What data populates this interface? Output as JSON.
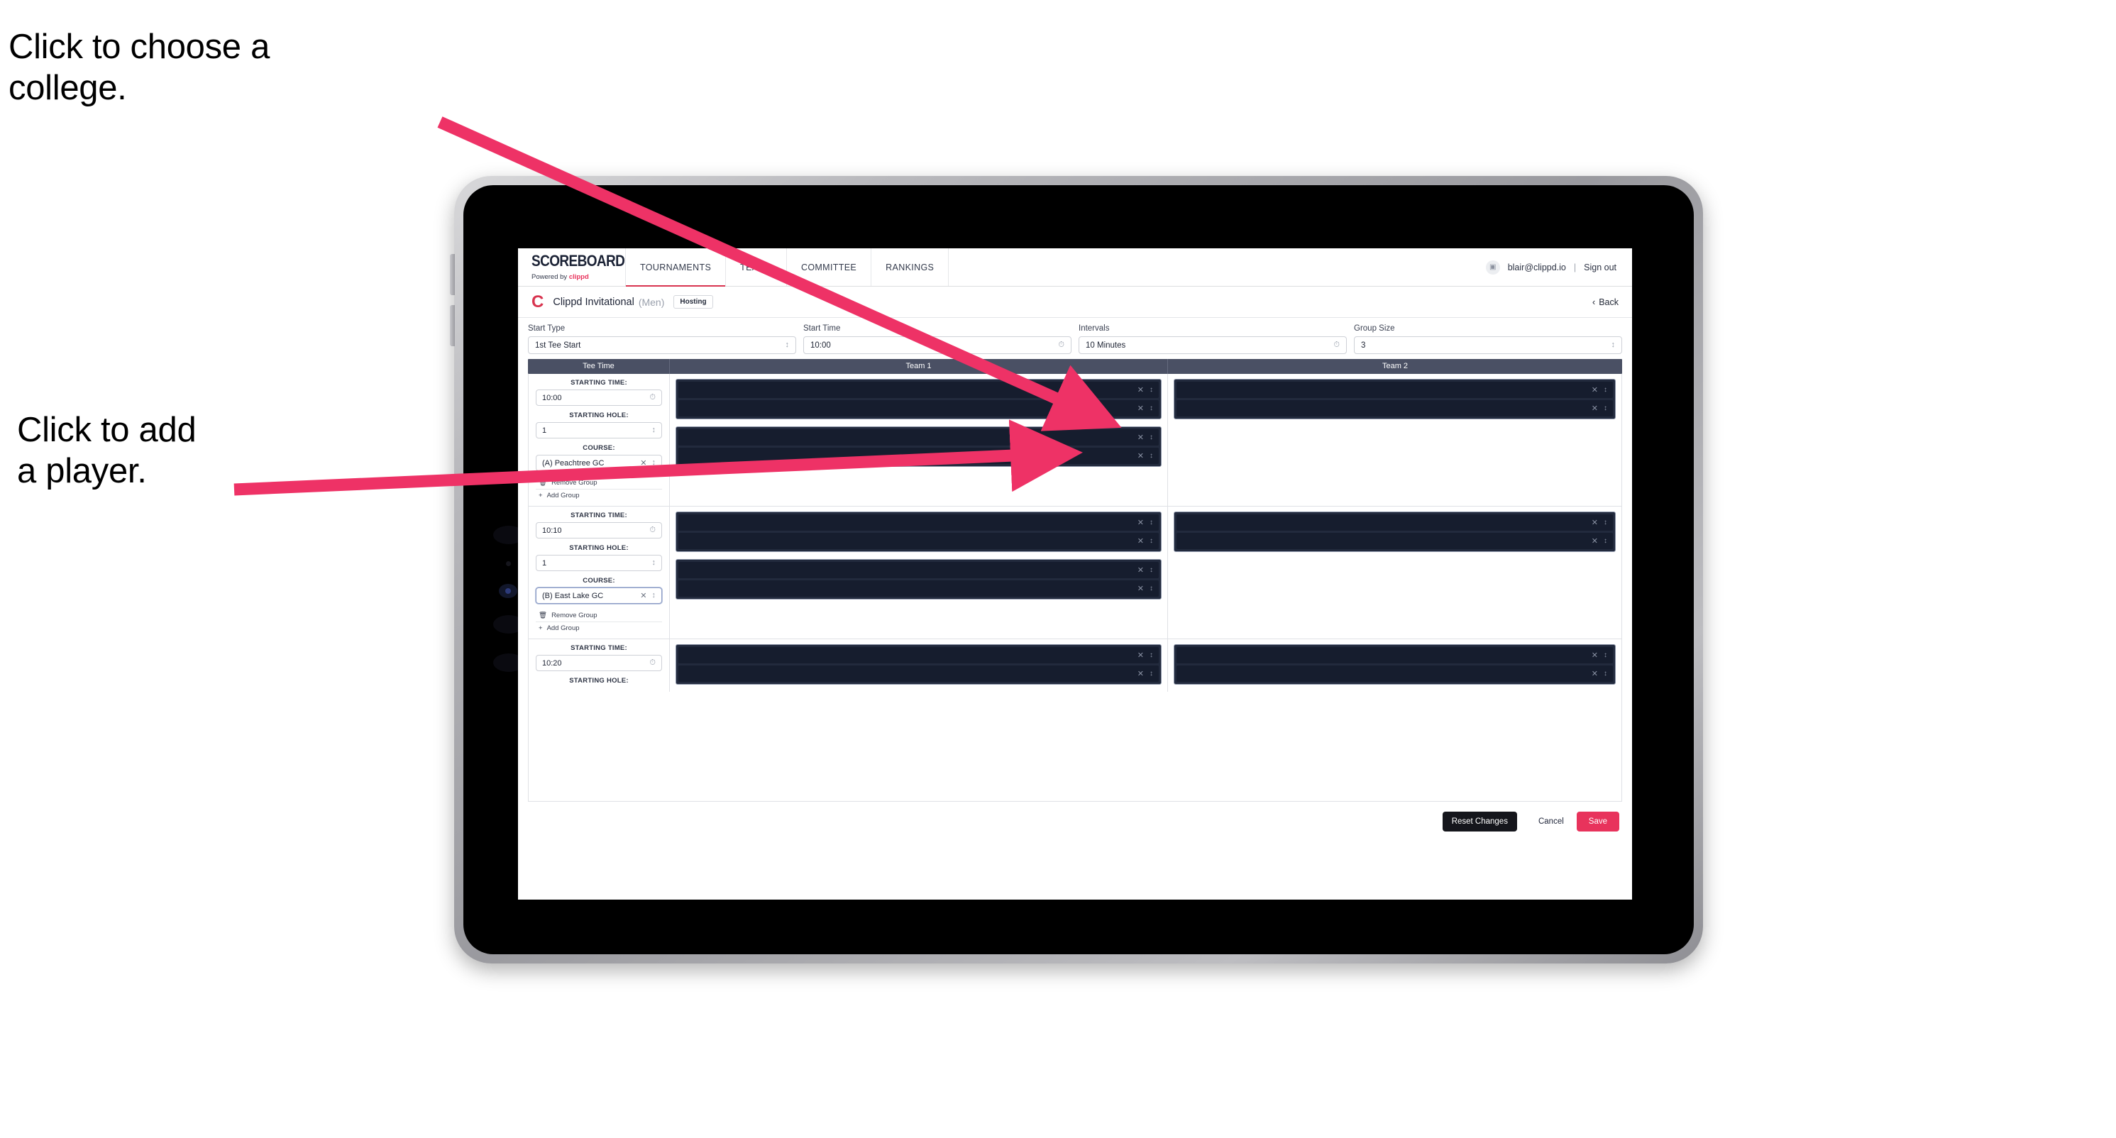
{
  "annotations": [
    {
      "id": "college",
      "text": "Click to choose a\ncollege."
    },
    {
      "id": "player",
      "text": "Click to add\na player."
    }
  ],
  "colors": {
    "accent_pink": "#e8335c",
    "tab_underline": "#d8344f",
    "table_header_bg": "#4a5064",
    "player_row_bg": "#161d2e",
    "annotation_arrow": "#ee3266"
  },
  "topnav": {
    "brand_title": "SCOREBOARD",
    "brand_sub_prefix": "Powered by",
    "brand_sub_name": "clippd",
    "tabs": [
      {
        "label": "TOURNAMENTS",
        "active": true
      },
      {
        "label": "TEAMS",
        "active": false
      },
      {
        "label": "COMMITTEE",
        "active": false
      },
      {
        "label": "RANKINGS",
        "active": false
      }
    ],
    "avatar_icon": "user-avatar-icon",
    "email": "blair@clippd.io",
    "separator": "|",
    "sign_out": "Sign out"
  },
  "tournament_bar": {
    "logo_letter": "C",
    "title": "Clippd Invitational",
    "gender": "(Men)",
    "badge": "Hosting",
    "back_label": "Back",
    "back_icon": "chevron-left-icon"
  },
  "settings": [
    {
      "label": "Start Type",
      "value": "1st Tee Start",
      "icon": "stepper-icon"
    },
    {
      "label": "Start Time",
      "value": "10:00",
      "icon": "clock-icon"
    },
    {
      "label": "Intervals",
      "value": "10 Minutes",
      "icon": "clock-icon"
    },
    {
      "label": "Group Size",
      "value": "3",
      "icon": "stepper-icon"
    }
  ],
  "table": {
    "headers": {
      "tee_time": "Tee Time",
      "team1": "Team 1",
      "team2": "Team 2"
    },
    "field_labels": {
      "starting_time": "STARTING TIME:",
      "starting_hole": "STARTING HOLE:",
      "course": "COURSE:"
    },
    "group_actions": {
      "remove": "Remove Group",
      "remove_icon": "trash-icon",
      "add": "Add Group",
      "add_icon": "plus-icon"
    },
    "row_icons": {
      "clear": "clear-x-icon",
      "stepper": "stepper-updown-icon"
    },
    "blocks": [
      {
        "starting_time": "10:00",
        "starting_hole": "1",
        "course": "(A) Peachtree GC",
        "course_focused": false,
        "team1_cards": [
          {
            "rows": 2
          },
          {
            "rows": 2
          }
        ],
        "team2_cards": [
          {
            "rows": 2
          }
        ]
      },
      {
        "starting_time": "10:10",
        "starting_hole": "1",
        "course": "(B) East Lake GC",
        "course_focused": true,
        "team1_cards": [
          {
            "rows": 2
          },
          {
            "rows": 2
          }
        ],
        "team2_cards": [
          {
            "rows": 2
          }
        ]
      },
      {
        "starting_time": "10:20",
        "starting_hole": "",
        "course": "",
        "course_focused": false,
        "team1_cards": [
          {
            "rows": 2
          }
        ],
        "team2_cards": [
          {
            "rows": 2
          }
        ]
      }
    ]
  },
  "footer": {
    "reset": "Reset Changes",
    "cancel": "Cancel",
    "save": "Save"
  }
}
